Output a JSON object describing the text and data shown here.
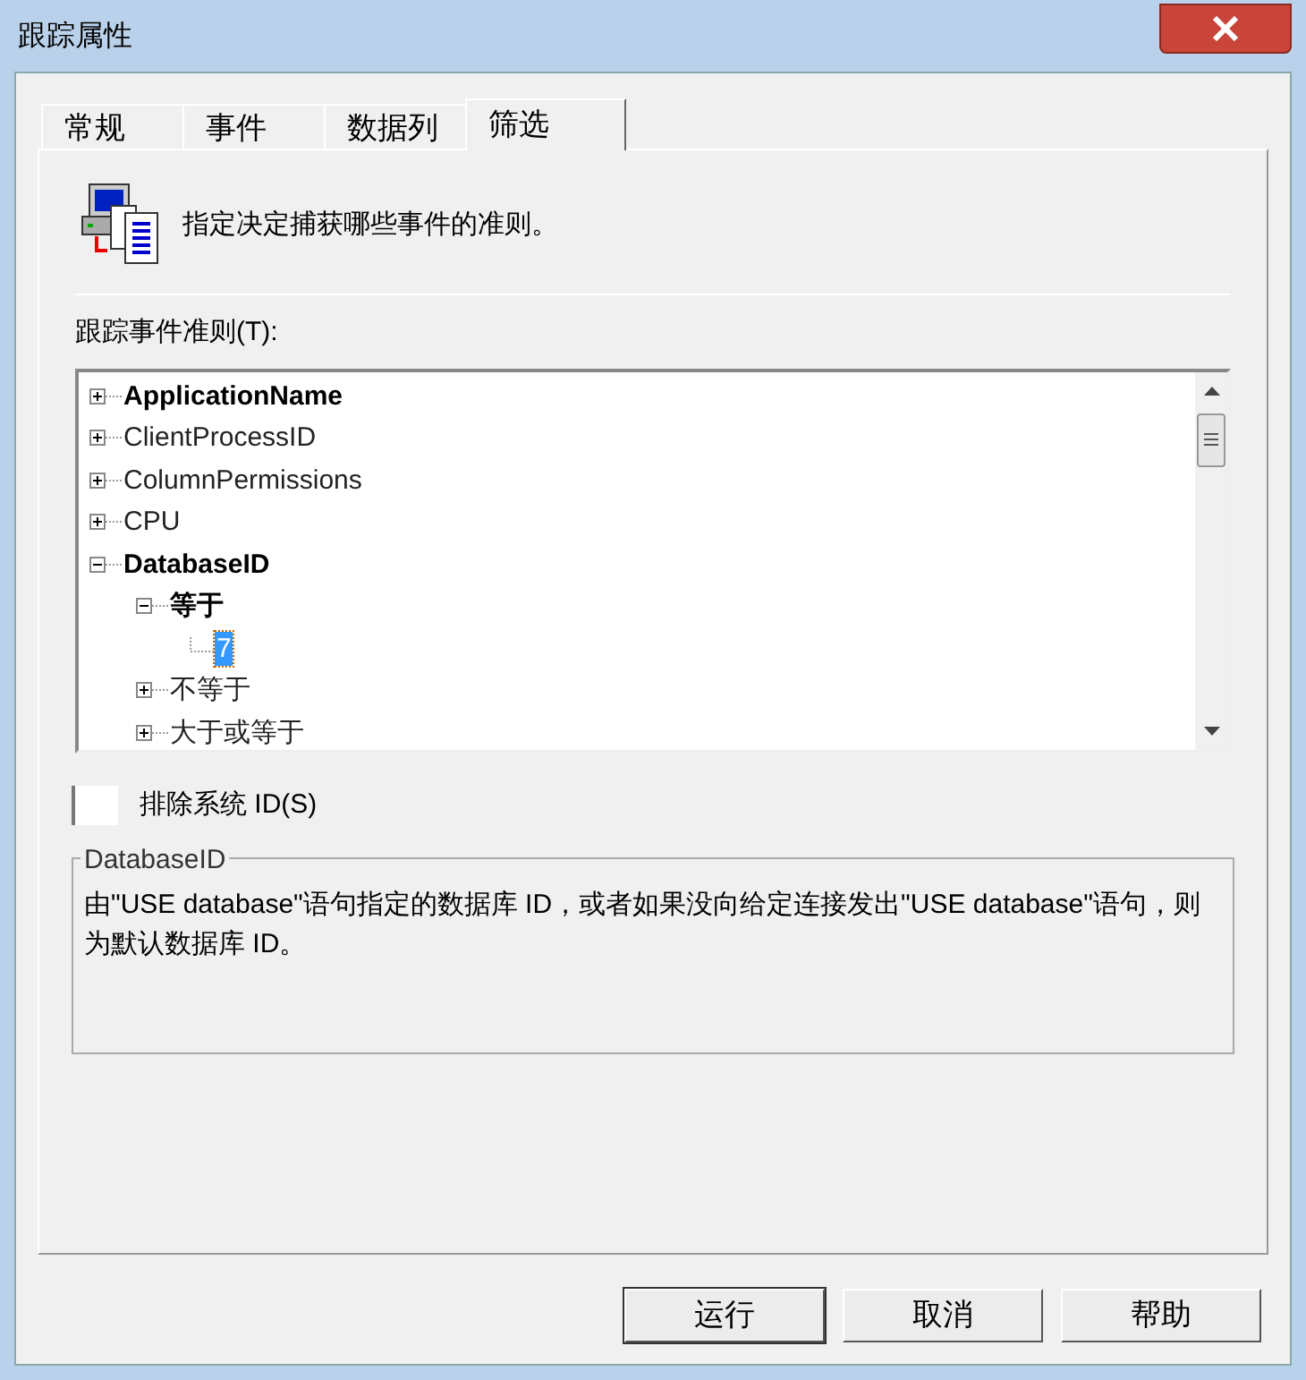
{
  "window": {
    "title": "跟踪属性"
  },
  "tabs": [
    {
      "label": "常规",
      "selected": false
    },
    {
      "label": "事件",
      "selected": false
    },
    {
      "label": "数据列",
      "selected": false
    },
    {
      "label": "筛选",
      "selected": true
    }
  ],
  "header": {
    "text": "指定决定捕获哪些事件的准则。"
  },
  "tree": {
    "label": "跟踪事件准则(T):",
    "items": [
      {
        "label": "ApplicationName",
        "filtered": true,
        "expanded": false,
        "selected": false
      },
      {
        "label": "ClientProcessID",
        "filtered": false,
        "expanded": false,
        "selected": false
      },
      {
        "label": "ColumnPermissions",
        "filtered": false,
        "expanded": false,
        "selected": false
      },
      {
        "label": "CPU",
        "filtered": false,
        "expanded": false,
        "selected": false
      },
      {
        "label": "DatabaseID",
        "filtered": true,
        "expanded": true,
        "selected": false,
        "children": [
          {
            "label": "等于",
            "filtered": true,
            "expanded": true,
            "selected": false,
            "children": [
              {
                "label": "7",
                "filtered": false,
                "selected": true
              }
            ]
          },
          {
            "label": "不等于",
            "filtered": false,
            "expanded": false,
            "selected": false
          },
          {
            "label": "大于或等于",
            "filtered": false,
            "expanded": false,
            "selected": false
          }
        ]
      }
    ]
  },
  "exclude_system": {
    "label": "排除系统 ID(S)",
    "checked": false
  },
  "description": {
    "title": "DatabaseID",
    "text": "由\"USE database\"语句指定的数据库 ID，或者如果没向给定连接发出\"USE database\"语句，则为默认数据库 ID。"
  },
  "buttons": [
    "运行",
    "取消",
    "帮助"
  ]
}
